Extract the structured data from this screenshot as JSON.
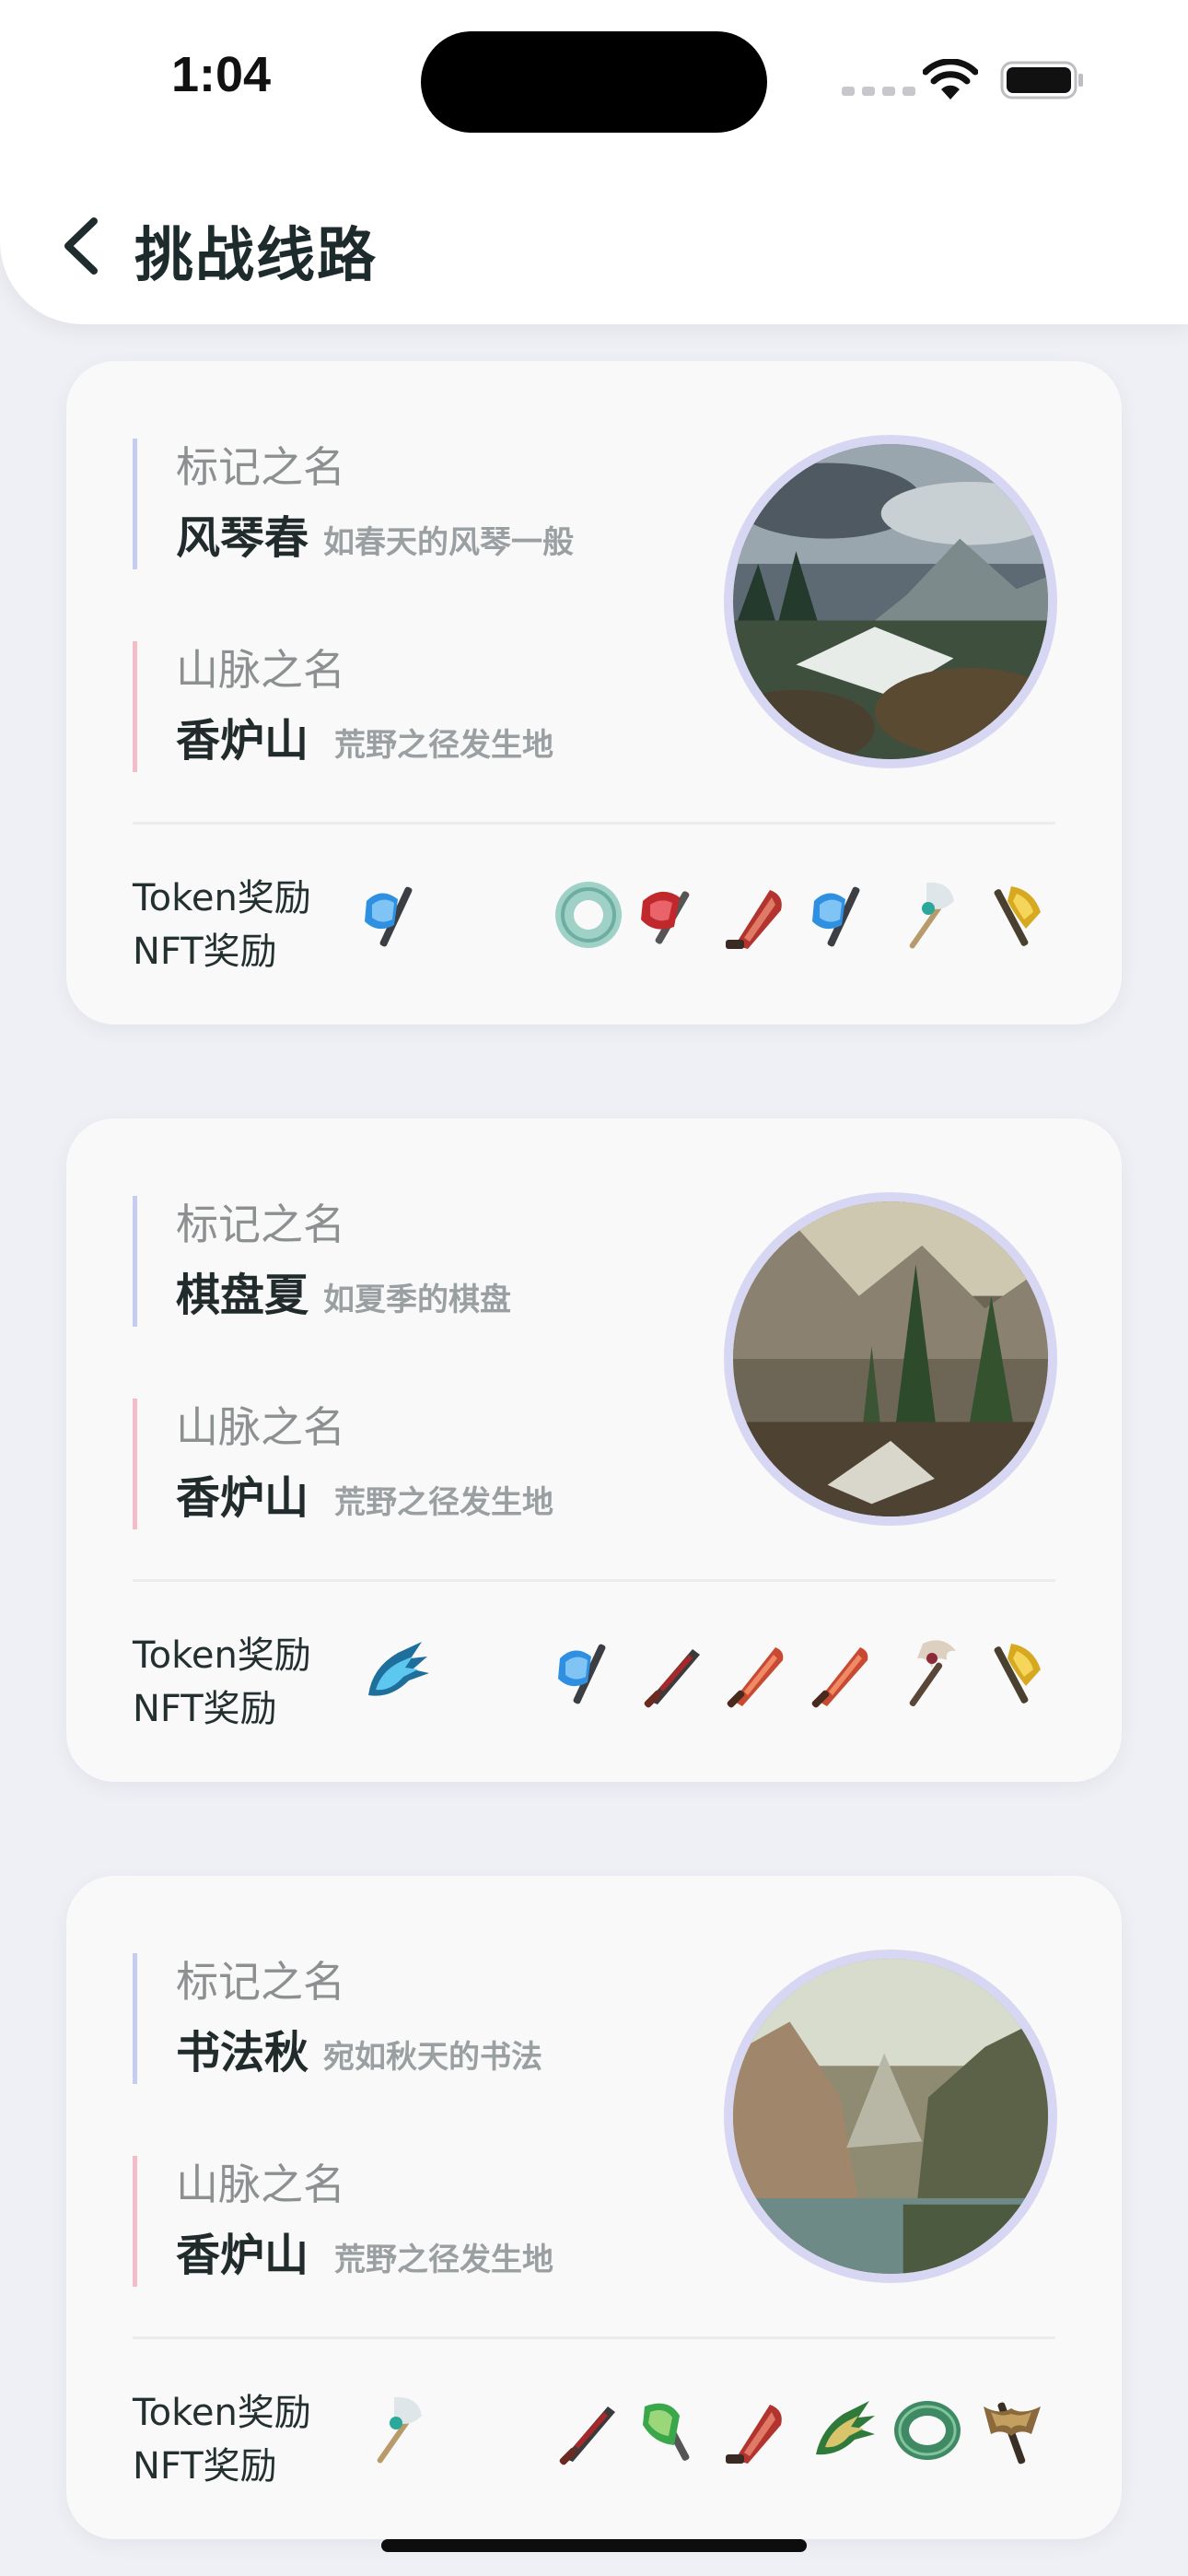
{
  "status_bar": {
    "time": "1:04"
  },
  "header": {
    "title": "挑战线路"
  },
  "reward_labels": {
    "token": "Token奖励",
    "nft": "NFT奖励"
  },
  "cards": [
    {
      "mark_label": "标记之名",
      "mark_name": "风琴春",
      "mark_desc": "如春天的风琴一般",
      "mountain_label": "山脉之名",
      "mountain_name": "香炉山",
      "mountain_desc": "荒野之径发生地",
      "photo_subject": "waterfall-mountain-landscape",
      "token_icon": "blue-axe-icon",
      "nft_icons": [
        "jade-ring-icon",
        "red-axe-icon",
        "red-blade-icon",
        "blue-axe-icon",
        "staff-icon",
        "gold-axe-icon"
      ]
    },
    {
      "mark_label": "标记之名",
      "mark_name": "棋盘夏",
      "mark_desc": "如夏季的棋盘",
      "mountain_label": "山脉之名",
      "mountain_name": "香炉山",
      "mountain_desc": "荒野之径发生地",
      "photo_subject": "pine-forest-gorge-landscape",
      "token_icon": "blue-claw-icon",
      "nft_icons": [
        "blue-axe-icon",
        "dark-sword-icon",
        "red-sword-icon",
        "red-sword-icon",
        "bone-staff-icon",
        "gold-axe-icon"
      ]
    },
    {
      "mark_label": "标记之名",
      "mark_name": "书法秋",
      "mark_desc": "宛如秋天的书法",
      "mountain_label": "山脉之名",
      "mountain_name": "香炉山",
      "mountain_desc": "荒野之径发生地",
      "photo_subject": "mountain-lake-landscape",
      "token_icon": "staff-icon",
      "nft_icons": [
        "dark-sword-icon",
        "green-axe-icon",
        "red-blade-icon",
        "green-claw-icon",
        "jade-ring-icon",
        "bronze-axe-icon"
      ]
    }
  ],
  "colors": {
    "background": "#eff0f5",
    "card": "#f9f9fa",
    "mark_accent": "#c6cdee",
    "mountain_accent": "#f2bdc8",
    "photo_ring": "#d8d7f3"
  }
}
